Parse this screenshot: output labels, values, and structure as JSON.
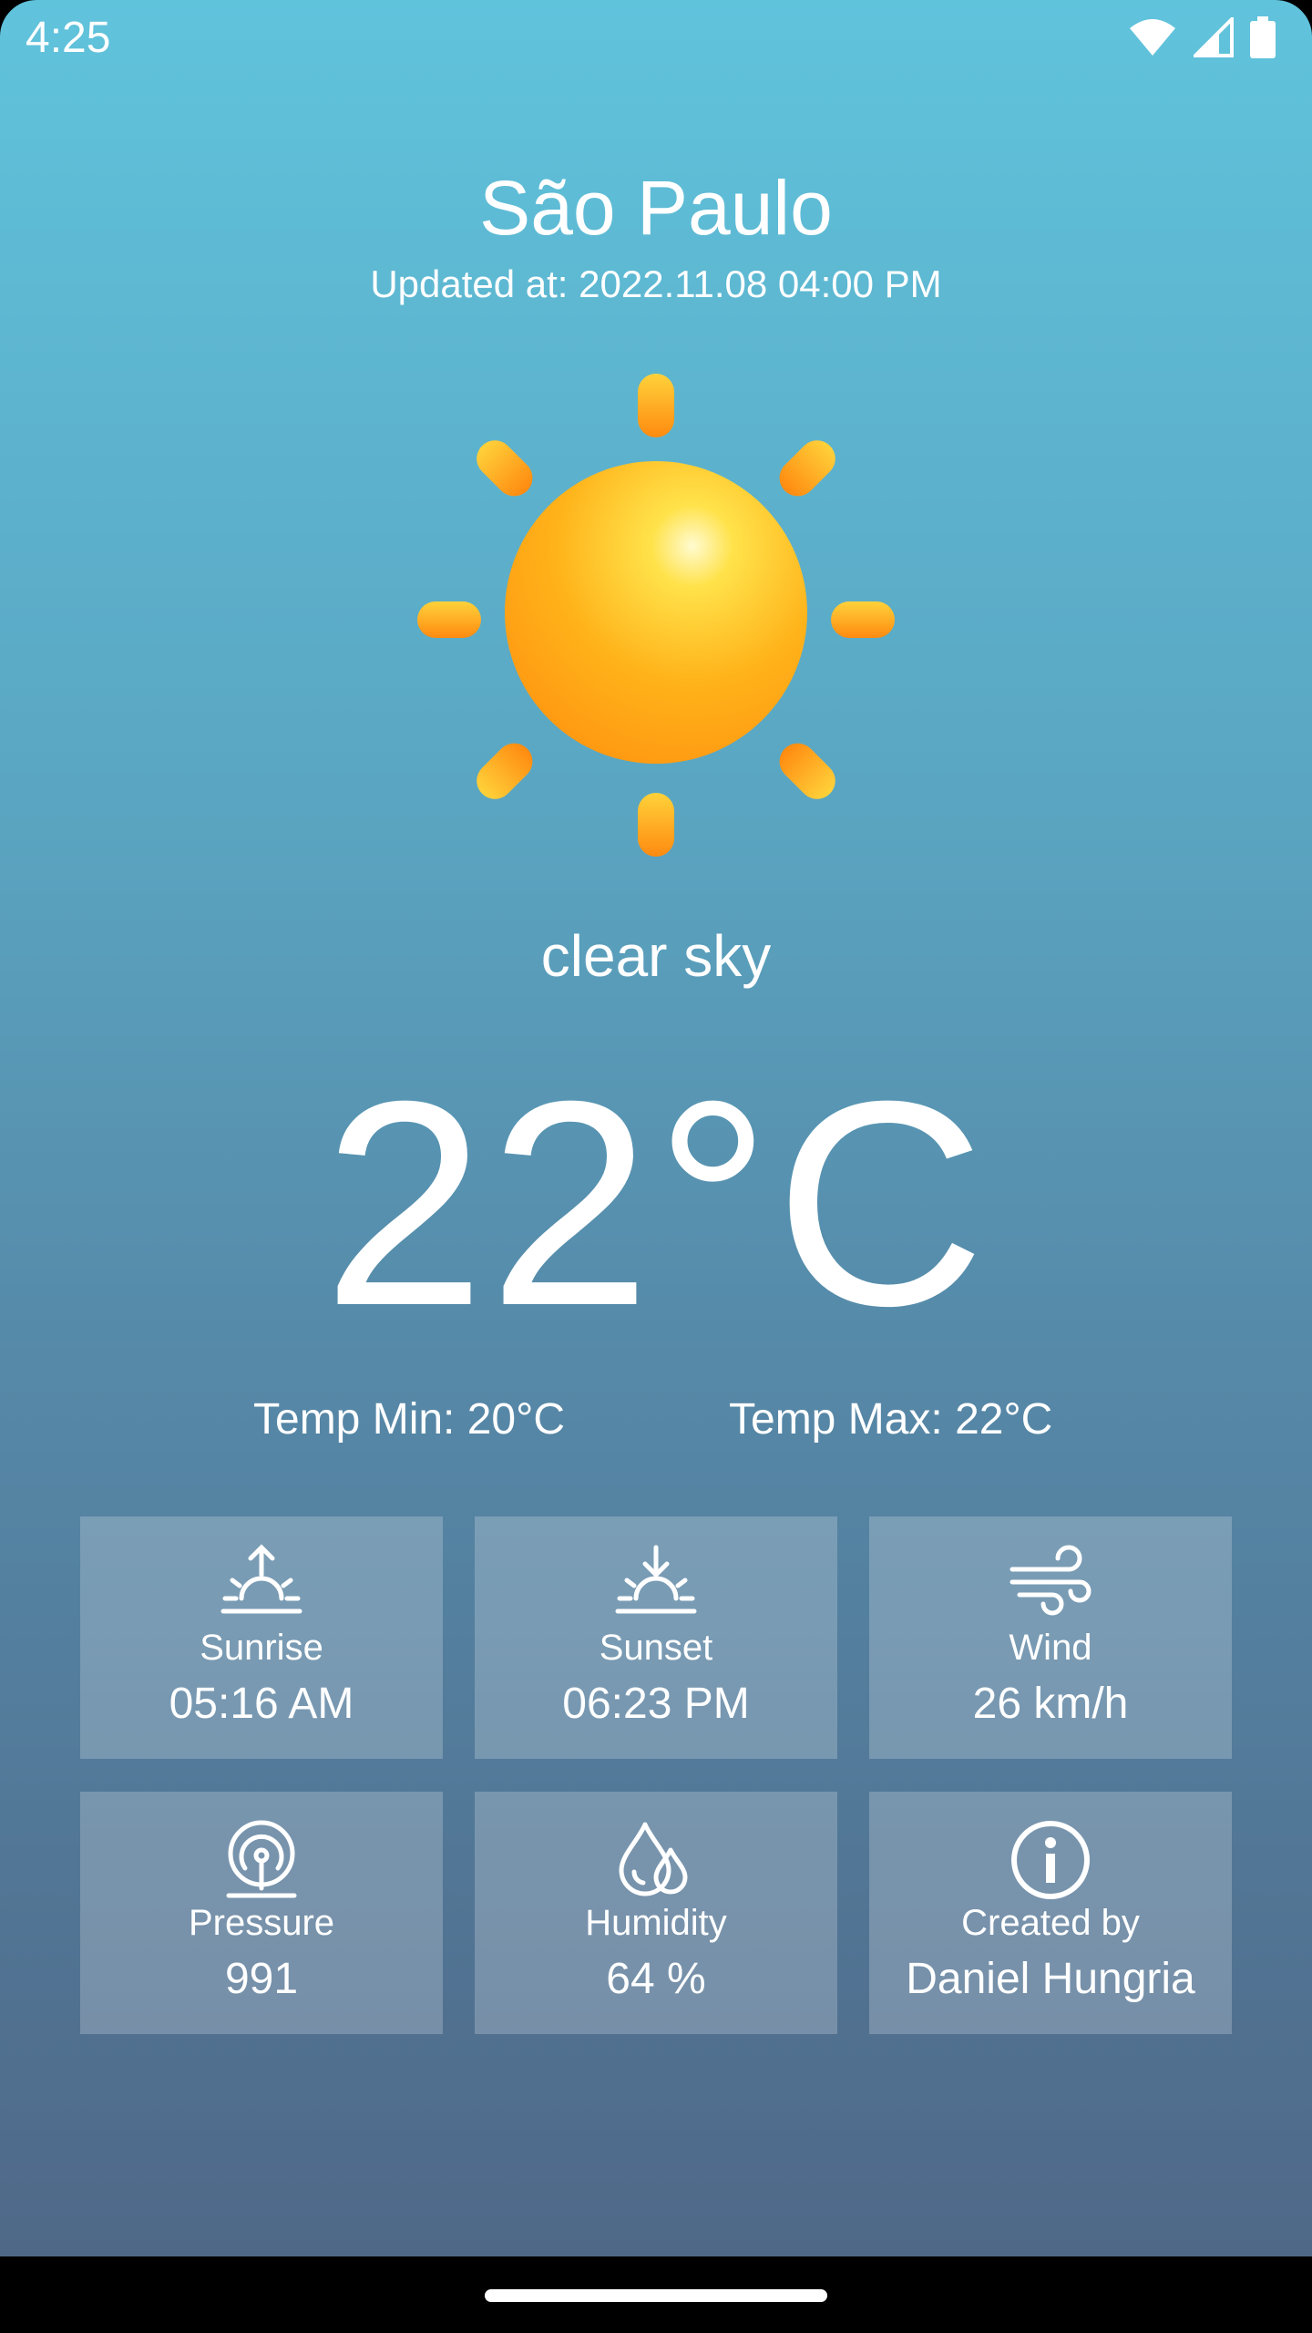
{
  "status_bar": {
    "time": "4:25"
  },
  "weather": {
    "city": "São Paulo",
    "updated": "Updated at: 2022.11.08 04:00 PM",
    "description": "clear sky",
    "temperature": "22°C",
    "temp_min": "Temp Min: 20°C",
    "temp_max": "Temp Max: 22°C"
  },
  "cards": [
    {
      "label": "Sunrise",
      "value": "05:16 AM",
      "icon": "sunrise-icon"
    },
    {
      "label": "Sunset",
      "value": "06:23 PM",
      "icon": "sunset-icon"
    },
    {
      "label": "Wind",
      "value": "26 km/h",
      "icon": "wind-icon"
    },
    {
      "label": "Pressure",
      "value": "991",
      "icon": "pressure-gauge-icon"
    },
    {
      "label": "Humidity",
      "value": "64 %",
      "icon": "humidity-drops-icon"
    },
    {
      "label": "Created by",
      "value": "Daniel Hungria",
      "icon": "info-icon"
    }
  ],
  "colors": {
    "gradient_top": "#60c3dc",
    "gradient_bottom": "#4f6888",
    "sun": "#ffb31a"
  }
}
